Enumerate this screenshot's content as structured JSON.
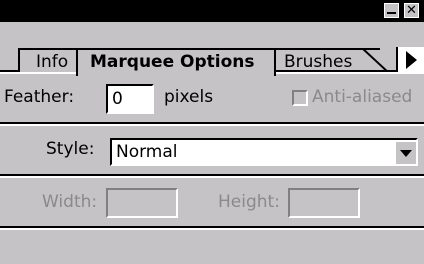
{
  "tabs": {
    "info": "Info",
    "marquee": "Marquee Options",
    "brushes": "Brushes"
  },
  "feather": {
    "label": "Feather:",
    "value": "0",
    "unit": "pixels"
  },
  "antialiased": {
    "label": "Anti-aliased",
    "checked": false
  },
  "style": {
    "label": "Style:",
    "value": "Normal"
  },
  "size": {
    "width_label": "Width:",
    "width_value": "",
    "height_label": "Height:",
    "height_value": ""
  },
  "colors": {
    "face": "#c6c3c6",
    "titlebar": "#000000",
    "disabled_text": "#8a8a8a"
  }
}
